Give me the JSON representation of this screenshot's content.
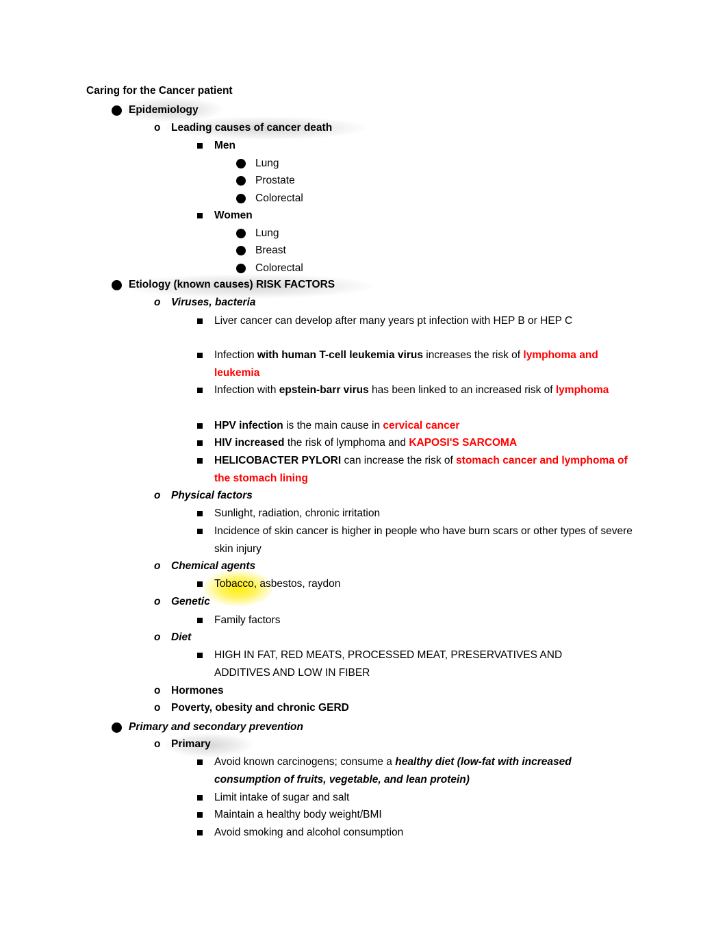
{
  "document": {
    "title": "Caring for the Cancer patient",
    "colors": {
      "text": "#000000",
      "accent_red": "#FF0000",
      "highlight_yellow": "#FFEE00",
      "glow_gray": "#787878",
      "page_background": "#FFFFFF"
    }
  },
  "outline": {
    "sections": [
      {
        "id": "epidemiology",
        "label": "Epidemiology",
        "children": [
          {
            "id": "leading-causes",
            "label": "Leading causes of cancer death",
            "children": [
              {
                "id": "men",
                "label": "Men",
                "children": [
                  {
                    "id": "men-lung",
                    "label": "Lung"
                  },
                  {
                    "id": "men-prostate",
                    "label": "Prostate"
                  },
                  {
                    "id": "men-colorectal",
                    "label": "Colorectal"
                  }
                ]
              },
              {
                "id": "women",
                "label": "Women",
                "children": [
                  {
                    "id": "women-lung",
                    "label": "Lung"
                  },
                  {
                    "id": "women-breast",
                    "label": "Breast"
                  },
                  {
                    "id": "women-colorectal",
                    "label": "Colorectal"
                  }
                ]
              }
            ]
          }
        ]
      },
      {
        "id": "etiology",
        "label": "Etiology (known causes) RISK FACTORS",
        "children": [
          {
            "id": "viruses-bacteria",
            "label": "Viruses, bacteria",
            "items": [
              "Liver cancer can develop after many years pt infection with HEP B or HEP C",
              "Infection with human T-cell leukemia virus increases the risk of lymphoma and leukemia",
              "Infection with epstein-barr virus has been linked to an increased risk of lymphoma",
              "HPV infection is the main cause in cervical cancer",
              "HIV increased the risk of lymphoma and KAPOSI'S SARCOMA",
              "HELICOBACTER PYLORI can increase the risk of stomach cancer and lymphoma of the stomach lining"
            ]
          },
          {
            "id": "physical-factors",
            "label": "Physical factors",
            "items": [
              "Sunlight, radiation, chronic irritation",
              "Incidence of skin cancer is higher in people who have burn scars or other types of severe skin injury"
            ]
          },
          {
            "id": "chemical-agents",
            "label": "Chemical agents",
            "items": [
              "Tobacco, asbestos, raydon"
            ]
          },
          {
            "id": "genetic",
            "label": "Genetic",
            "items": [
              "Family factors"
            ]
          },
          {
            "id": "diet",
            "label": "Diet",
            "items": [
              "HIGH IN FAT, RED MEATS, PROCESSED MEAT, PRESERVATIVES AND ADDITIVES AND LOW IN FIBER"
            ]
          },
          {
            "id": "hormones",
            "label": "Hormones",
            "items": []
          },
          {
            "id": "poverty",
            "label": "Poverty, obesity and chronic GERD",
            "items": []
          }
        ]
      },
      {
        "id": "prevention",
        "label": "Primary and secondary prevention",
        "children": [
          {
            "id": "primary",
            "label": "Primary",
            "items": [
              "Avoid known carcinogens; consume a healthy diet (low-fat with increased consumption of fruits, vegetable, and lean protein)",
              "Limit intake of sugar and salt",
              "Maintain a healthy body weight/BMI",
              "Avoid smoking and alcohol consumption"
            ]
          }
        ]
      }
    ]
  },
  "text": {
    "title": "Caring for the Cancer patient",
    "epidemiology": "Epidemiology",
    "leading_causes": "Leading causes of cancer death",
    "men": "Men",
    "men_lung": "Lung",
    "men_prostate": "Prostate",
    "men_colorectal": "Colorectal",
    "women": "Women",
    "women_lung": "Lung",
    "women_breast": "Breast",
    "women_colorectal": "Colorectal",
    "etiology": "Etiology (known causes) RISK FACTORS",
    "viruses_bacteria": "Viruses, bacteria",
    "v1_a": "Liver cancer can develop after many years pt infection with HEP B or HEP C",
    "v2_a": "Infection ",
    "v2_b": "with human T-cell leukemia virus",
    "v2_c": " increases the risk of ",
    "v2_d": "lymphoma and leukemia",
    "v3_a": "Infection with ",
    "v3_b": "epstein-barr virus",
    "v3_c": " has been linked to an increased risk of ",
    "v3_d": "lymphoma",
    "v4_a": "HPV infection",
    "v4_b": " is the main cause in ",
    "v4_c": "cervical cancer",
    "v5_a": "HIV increased",
    "v5_b": " the risk of lymphoma and ",
    "v5_c": "KAPOSI'S SARCOMA",
    "v6_a": "HELICOBACTER PYLORI",
    "v6_b": " can increase the risk of ",
    "v6_c": "stomach cancer and lymphoma of the stomach lining",
    "physical_factors": "Physical factors",
    "p1": "Sunlight, radiation, chronic irritation",
    "p2": "Incidence of skin cancer is higher in people who have burn scars or other types of severe skin injury",
    "chemical_agents": "Chemical agents",
    "c1_a": "Tobacco",
    "c1_b": ", asbestos, raydon",
    "genetic": "Genetic",
    "g1": "Family factors",
    "diet": "Diet",
    "d1": "HIGH IN FAT, RED MEATS, PROCESSED MEAT, PRESERVATIVES AND ADDITIVES AND LOW IN FIBER",
    "hormones": "Hormones",
    "poverty": "Poverty, obesity and chronic GERD",
    "prevention": "Primary and secondary prevention",
    "primary": "Primary",
    "pr1_a": "Avoid known carcinogens; consume a ",
    "pr1_b": "healthy diet (low-fat with increased consumption of fruits, vegetable, and lean protein)",
    "pr2": "Limit intake of sugar and salt",
    "pr3": "Maintain a healthy body weight/BMI",
    "pr4": "Avoid smoking and alcohol consumption"
  }
}
